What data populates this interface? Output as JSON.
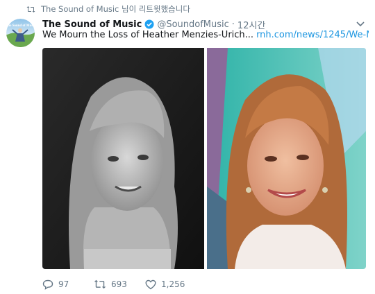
{
  "retweet_context": {
    "text": "The Sound of Music 님이 리트윗했습니다",
    "icon": "retweet-icon"
  },
  "author": {
    "display_name": "The Sound of Music",
    "handle": "@SoundofMusic",
    "separator": "·",
    "time": "12시간",
    "verified": true
  },
  "tweet": {
    "text": "We Mourn the Loss of Heather Menzies-Urich...",
    "link": "rnh.com/news/1245/We-M..."
  },
  "media": {
    "photos": [
      "bw-portrait-young-woman",
      "color-portrait-older-woman"
    ]
  },
  "actions": {
    "reply_count": "97",
    "retweet_count": "693",
    "like_count": "1,256"
  },
  "colors": {
    "link": "#1b95e0",
    "secondary_text": "#657786",
    "verified": "#1da1f2"
  }
}
